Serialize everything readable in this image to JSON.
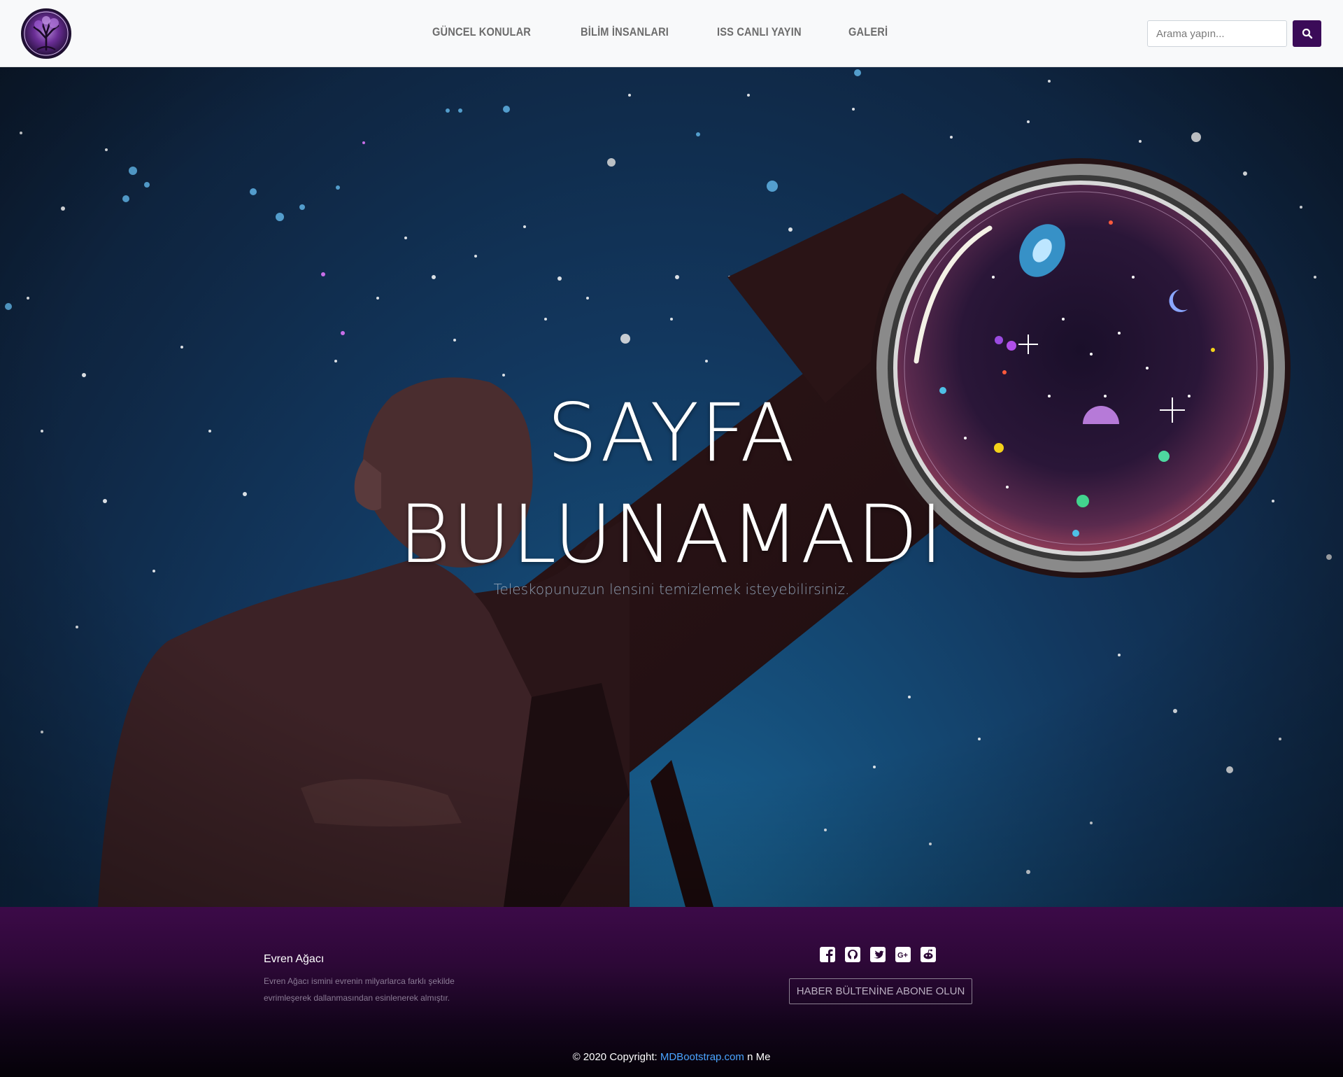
{
  "nav": {
    "logo_alt": "Evren Ağacı logo",
    "links": [
      "GÜNCEL KONULAR",
      "BİLİM İNSANLARI",
      "ISS CANLI YAYIN",
      "GALERİ"
    ],
    "search_placeholder": "Arama yapın...",
    "search_icon": "search-icon"
  },
  "hero": {
    "title_line1": "SAYFA",
    "title_line2": "BULUNAMADI",
    "subtitle": "Teleskopunuzun lensini temizlemek isteyebilirsiniz."
  },
  "footer": {
    "brand": "Evren Ağacı",
    "description": "Evren Ağacı ismini evrenin milyarlarca farklı şekilde evrimleşerek dallanmasından esinlenerek almıştır.",
    "social_icons": [
      "facebook-icon",
      "github-icon",
      "twitter-icon",
      "google-plus-icon",
      "reddit-icon"
    ],
    "newsletter_button": "HABER BÜLTENİNE ABONE OLUN",
    "copyright_prefix": "© 2020 Copyright: ",
    "copyright_link": "MDBootstrap.com",
    "copyright_suffix": " n Me"
  },
  "colors": {
    "accent": "#3b0b58",
    "footer_top": "#3c0a48",
    "link": "#4aa3ff"
  }
}
